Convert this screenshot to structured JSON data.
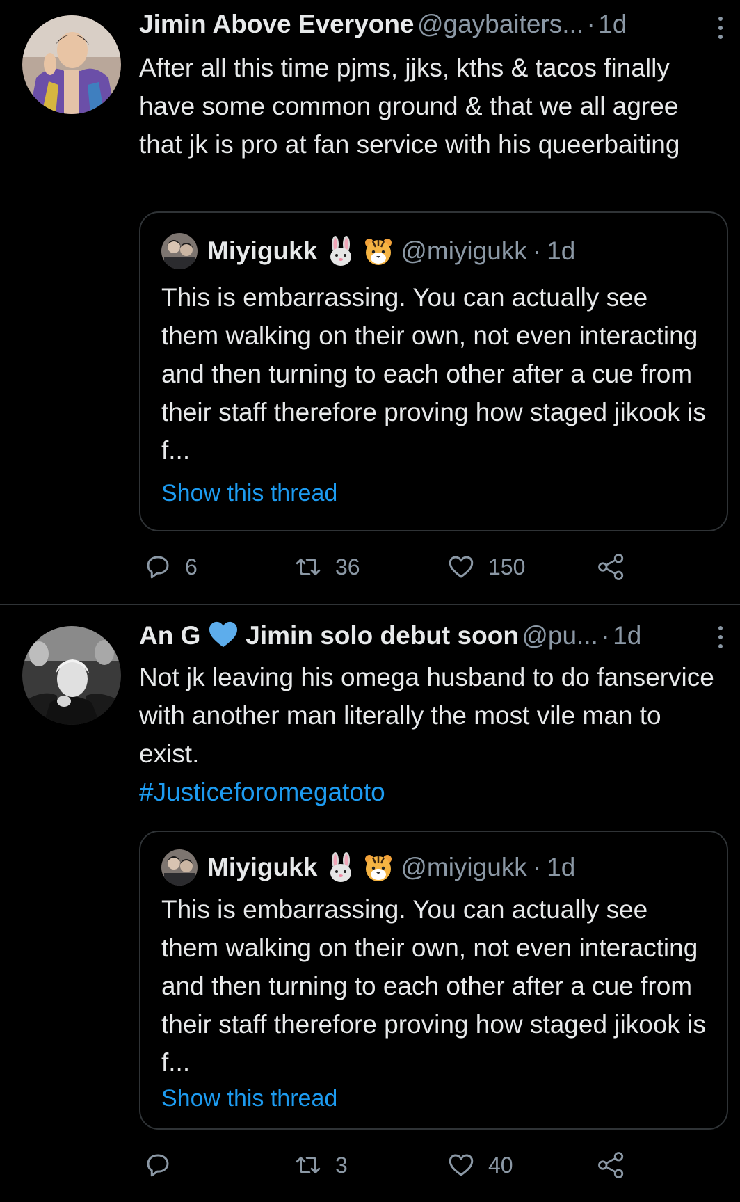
{
  "colors": {
    "background": "#000000",
    "text": "#e7e9ea",
    "muted": "#8b98a5",
    "link": "#1d9bf0",
    "border": "#2f3336"
  },
  "tweets": [
    {
      "name": "Jimin Above Everyone",
      "handle": "@gaybaiters...",
      "dot": "·",
      "time": "1d",
      "text": "After all this time pjms, jjks, kths & tacos finally have some common ground & that we all agree that jk is pro at fan service with his queerbaiting",
      "hashtag": "",
      "quote": {
        "name": "Miyigukk",
        "emojis": [
          "rabbit-emoji",
          "tiger-emoji"
        ],
        "handle": "@miyigukk",
        "dot": "·",
        "time": "1d",
        "text": "This is embarrassing. You can actually see them walking on their own, not even interacting and then turning to each other after a cue from their staff therefore proving how staged jikook is f...",
        "show_thread": "Show this thread"
      },
      "actions": {
        "replies": "6",
        "retweets": "36",
        "likes": "150"
      }
    },
    {
      "name": "An G",
      "name_emoji": "blue-heart-emoji",
      "name_rest": "Jimin solo debut soon",
      "handle": "@pu...",
      "dot": "·",
      "time": "1d",
      "text": "Not jk leaving his omega husband to do fanservice with another man literally the most vile man to exist.",
      "hashtag": "#Justiceforomegatoto",
      "quote": {
        "name": "Miyigukk",
        "emojis": [
          "rabbit-emoji",
          "tiger-emoji"
        ],
        "handle": "@miyigukk",
        "dot": "·",
        "time": "1d",
        "text": "This is embarrassing. You can actually see them walking on their own, not even interacting and then turning to each other after a cue from their staff therefore proving how staged jikook is f...",
        "show_thread": "Show this thread"
      },
      "actions": {
        "replies": "",
        "retweets": "3",
        "likes": "40"
      }
    }
  ]
}
